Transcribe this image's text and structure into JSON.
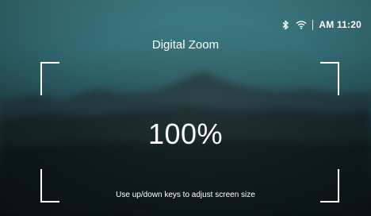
{
  "status_bar": {
    "bluetooth_icon": "bluetooth-icon",
    "wifi_icon": "wifi-icon",
    "time": "AM 11:20"
  },
  "title": "Digital Zoom",
  "zoom_value": "100%",
  "hint": "Use up/down keys to adjust screen size",
  "colors": {
    "text": "#ffffff",
    "frame": "#ffffff",
    "sky": "#3f7f86",
    "ground": "#0c1517"
  }
}
